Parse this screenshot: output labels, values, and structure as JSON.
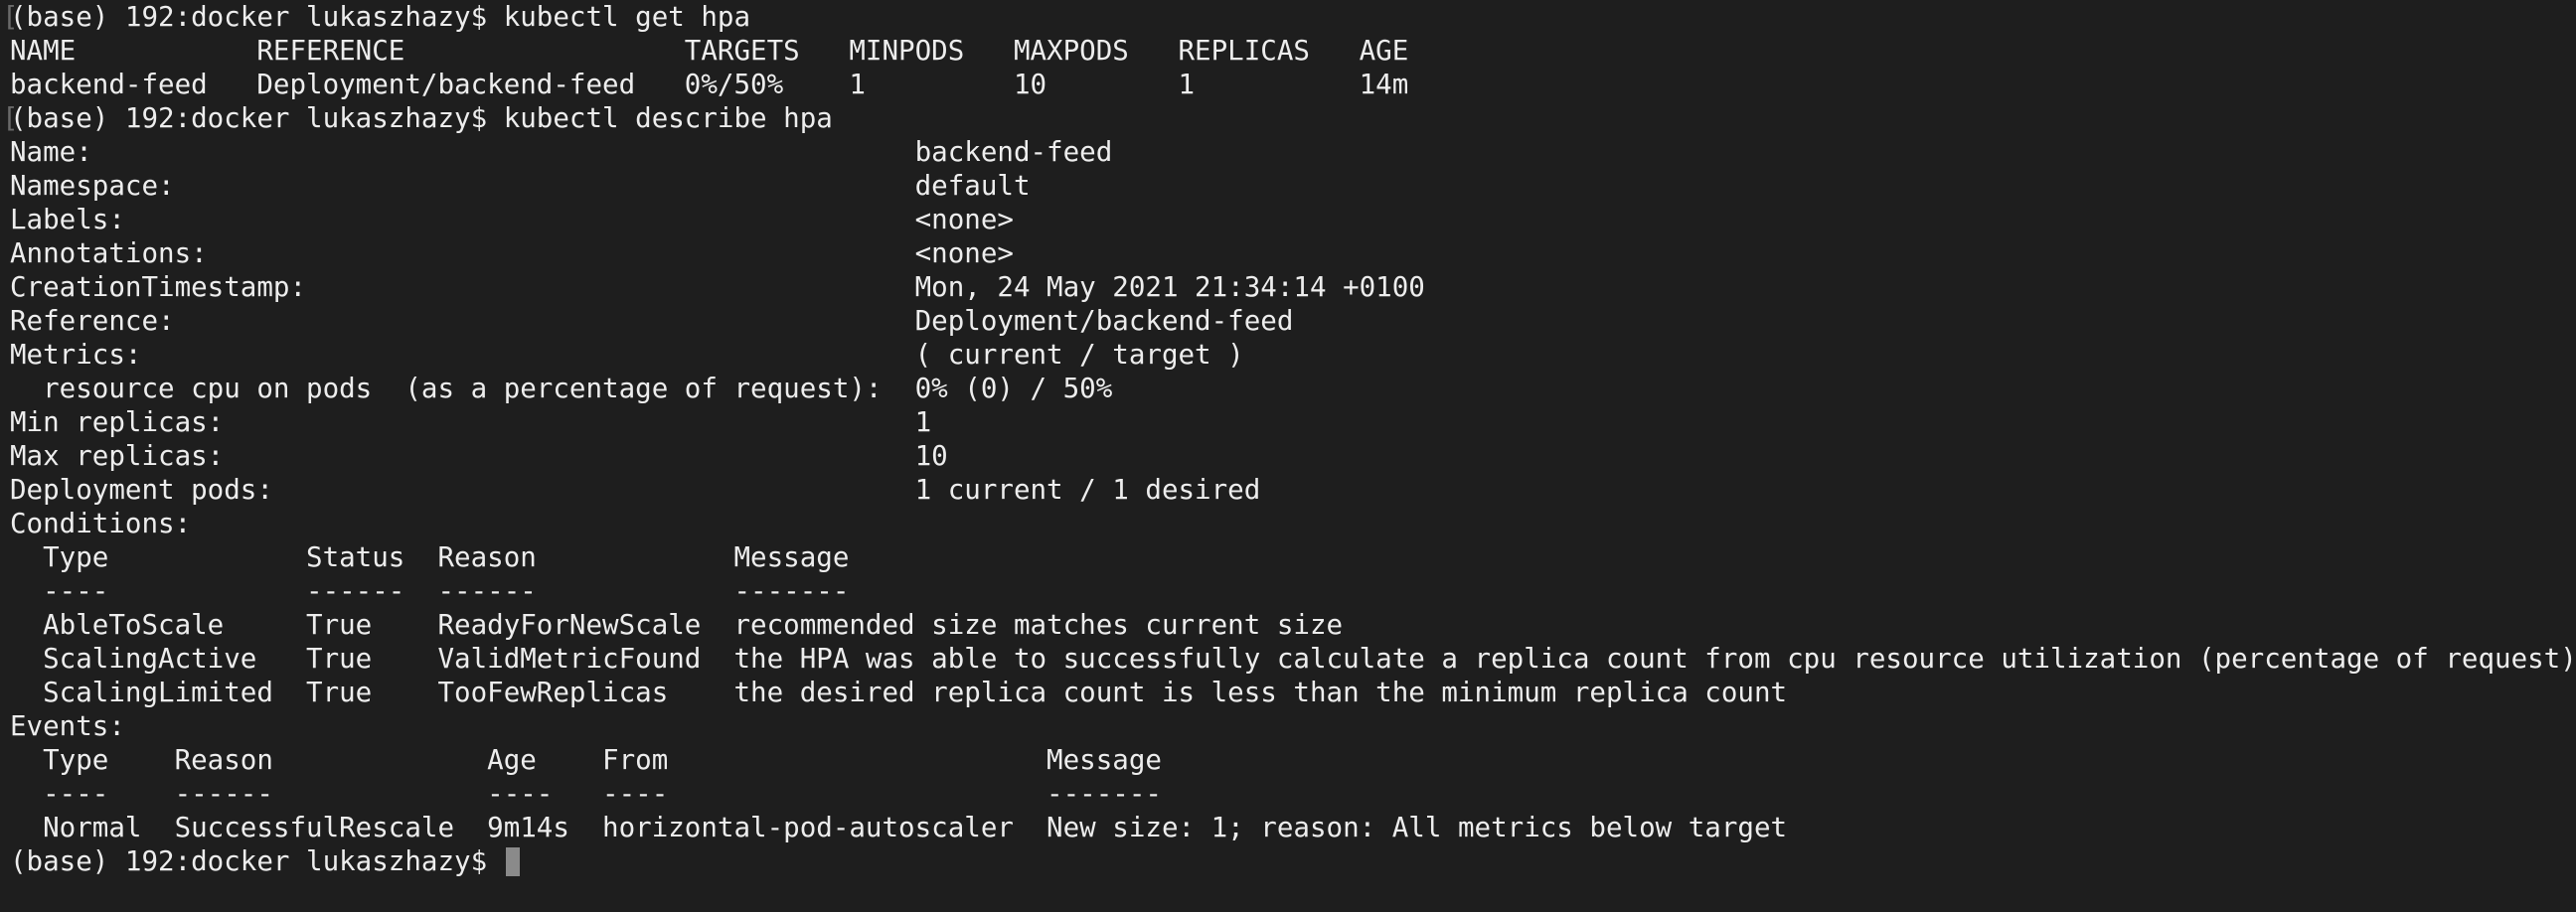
{
  "terminal": {
    "prompt_marker": "[",
    "lines": [
      {
        "text": "(base) 192:docker lukaszhazy$ kubectl get hpa",
        "marked": true
      },
      {
        "text": "NAME           REFERENCE                 TARGETS   MINPODS   MAXPODS   REPLICAS   AGE",
        "marked": false
      },
      {
        "text": "backend-feed   Deployment/backend-feed   0%/50%    1         10        1          14m",
        "marked": false
      },
      {
        "text": "(base) 192:docker lukaszhazy$ kubectl describe hpa",
        "marked": true
      },
      {
        "text": "Name:                                                  backend-feed",
        "marked": false
      },
      {
        "text": "Namespace:                                             default",
        "marked": false
      },
      {
        "text": "Labels:                                                <none>",
        "marked": false
      },
      {
        "text": "Annotations:                                           <none>",
        "marked": false
      },
      {
        "text": "CreationTimestamp:                                     Mon, 24 May 2021 21:34:14 +0100",
        "marked": false
      },
      {
        "text": "Reference:                                             Deployment/backend-feed",
        "marked": false
      },
      {
        "text": "Metrics:                                               ( current / target )",
        "marked": false
      },
      {
        "text": "  resource cpu on pods  (as a percentage of request):  0% (0) / 50%",
        "marked": false
      },
      {
        "text": "Min replicas:                                          1",
        "marked": false
      },
      {
        "text": "Max replicas:                                          10",
        "marked": false
      },
      {
        "text": "Deployment pods:                                       1 current / 1 desired",
        "marked": false
      },
      {
        "text": "Conditions:",
        "marked": false
      },
      {
        "text": "  Type            Status  Reason            Message",
        "marked": false
      },
      {
        "text": "  ----            ------  ------            -------",
        "marked": false
      },
      {
        "text": "  AbleToScale     True    ReadyForNewScale  recommended size matches current size",
        "marked": false
      },
      {
        "text": "  ScalingActive   True    ValidMetricFound  the HPA was able to successfully calculate a replica count from cpu resource utilization (percentage of request)",
        "marked": false
      },
      {
        "text": "  ScalingLimited  True    TooFewReplicas    the desired replica count is less than the minimum replica count",
        "marked": false
      },
      {
        "text": "Events:",
        "marked": false
      },
      {
        "text": "  Type    Reason             Age    From                       Message",
        "marked": false
      },
      {
        "text": "  ----    ------             ----   ----                       -------",
        "marked": false
      },
      {
        "text": "  Normal  SuccessfulRescale  9m14s  horizontal-pod-autoscaler  New size: 1; reason: All metrics below target",
        "marked": false
      }
    ],
    "prompt": "(base) 192:docker lukaszhazy$ "
  }
}
